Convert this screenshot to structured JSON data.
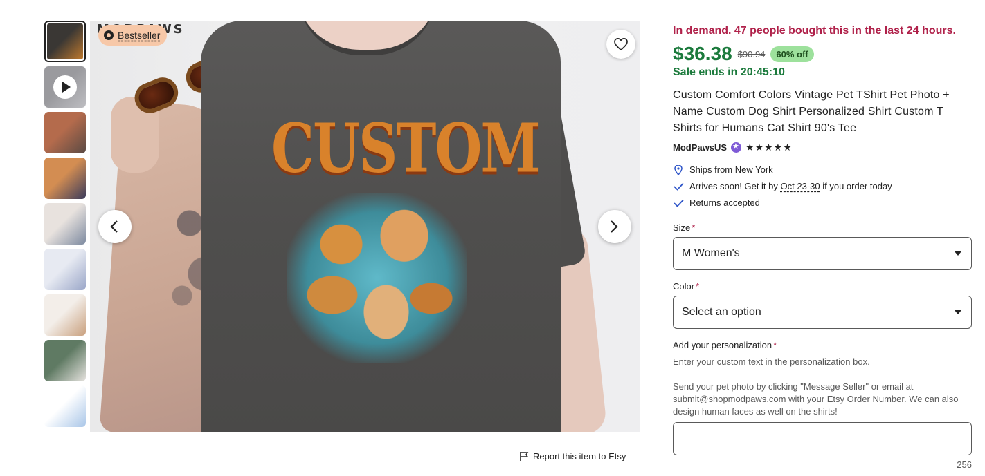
{
  "gallery": {
    "thumbnails": [
      {
        "label": "Thumbnail 1",
        "active": true,
        "colors": [
          "#3a3734",
          "#c07a2e"
        ]
      },
      {
        "label": "Thumbnail 2 video",
        "active": false,
        "video": true,
        "colors": [
          "#9a9a9e",
          "#bdbdc1"
        ]
      },
      {
        "label": "Thumbnail 3",
        "active": false,
        "colors": [
          "#b46b4c",
          "#5a4a44"
        ]
      },
      {
        "label": "Thumbnail 4",
        "active": false,
        "colors": [
          "#d38d52",
          "#3b3b5c"
        ]
      },
      {
        "label": "Thumbnail 5",
        "active": false,
        "colors": [
          "#e8e2de",
          "#7d8aa0"
        ]
      },
      {
        "label": "Thumbnail 6",
        "active": false,
        "colors": [
          "#e7eaf2",
          "#9aa6c8"
        ]
      },
      {
        "label": "Thumbnail 7",
        "active": false,
        "colors": [
          "#f3eee9",
          "#c9a07e"
        ]
      },
      {
        "label": "Thumbnail 8",
        "active": false,
        "colors": [
          "#5f7a63",
          "#e6e3df"
        ]
      },
      {
        "label": "Thumbnail 9",
        "active": false,
        "colors": [
          "#ffffff",
          "#a9c6e8"
        ]
      }
    ],
    "brand_partial": "MODPAWS",
    "badge": "Bestseller",
    "print_text": "CUSTOM"
  },
  "report_link": "Report this item to Etsy",
  "listing": {
    "demand_notice": "In demand. 47 people bought this in the last 24 hours.",
    "price": "$36.38",
    "original_price": "$90.94",
    "discount": "60% off",
    "sale_ends": "Sale ends in 20:45:10",
    "title": "Custom Comfort Colors Vintage Pet TShirt Pet Photo + Name Custom Dog Shirt Personalized Shirt Custom T Shirts for Humans Cat Shirt 90's Tee",
    "seller": "ModPawsUS",
    "rating_stars": "★★★★★",
    "rating": 5
  },
  "shipping": {
    "ships_from": "Ships from New York",
    "arrives_prefix": "Arrives soon! Get it by",
    "arrives_date": "Oct 23-30",
    "arrives_suffix": "if you order today",
    "returns": "Returns accepted"
  },
  "options": {
    "size_label": "Size",
    "size_value": "M Women's",
    "color_label": "Color",
    "color_value": "Select an option",
    "required_mark": "*"
  },
  "personalization": {
    "label": "Add your personalization",
    "hint": "Enter your custom text in the personalization box.",
    "instructions": "Send your pet photo by clicking \"Message Seller\" or email at submit@shopmodpaws.com with your Etsy Order Number. We can also design human faces as well on the shirts!",
    "value": "",
    "char_count": "256"
  },
  "colors": {
    "demand": "#b0214a",
    "price": "#1b7a3c",
    "discount_bg": "#9de19c",
    "badge_bg": "#f7c8a8",
    "icon_blue": "#2f56c9"
  },
  "icons": {
    "favorite": "heart-icon",
    "prev": "chevron-left-icon",
    "next": "chevron-right-icon",
    "report": "flag-icon",
    "ships": "location-pin-icon",
    "arrives": "check-icon",
    "returns": "check-icon",
    "select": "caret-down-icon",
    "star_seller": "star-seller-icon",
    "bestseller": "medal-icon",
    "video": "play-icon"
  }
}
